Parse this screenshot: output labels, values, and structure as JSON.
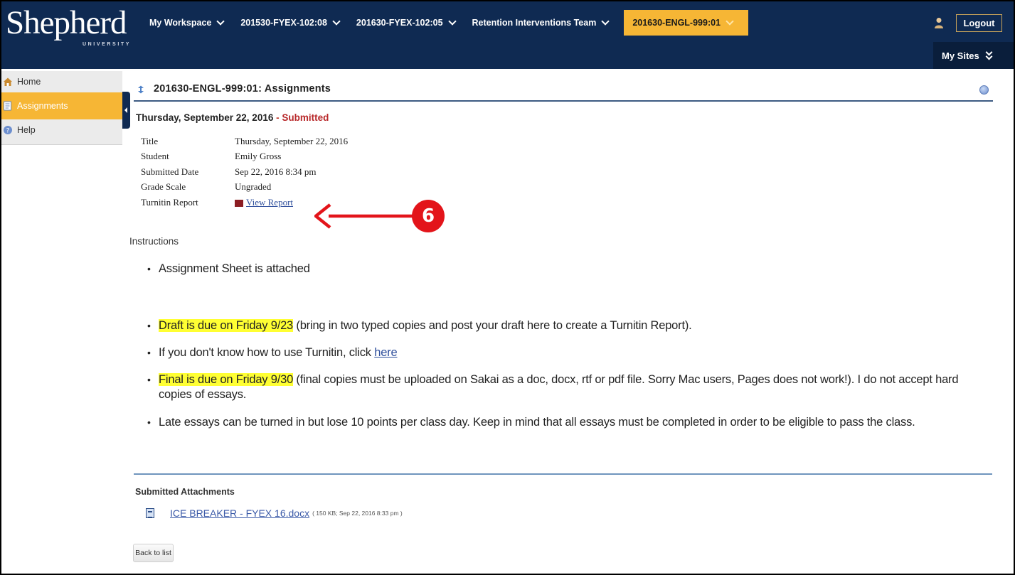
{
  "header": {
    "logo_text": "Shepherd",
    "logo_subtext": "UNIVERSITY",
    "nav_tabs": [
      {
        "label": "My Workspace"
      },
      {
        "label": "201530-FYEX-102:08"
      },
      {
        "label": "201630-FYEX-102:05"
      },
      {
        "label": "Retention Interventions Team"
      },
      {
        "label": "201630-ENGL-999:01",
        "active": true
      }
    ],
    "logout_label": "Logout",
    "my_sites_label": "My Sites"
  },
  "sidebar": {
    "items": [
      {
        "label": "Home",
        "icon": "home-icon"
      },
      {
        "label": "Assignments",
        "icon": "assignments-icon",
        "active": true
      },
      {
        "label": "Help",
        "icon": "help-icon"
      }
    ]
  },
  "main": {
    "page_title": "201630-ENGL-999:01: Assignments",
    "assignment_heading": "Thursday, September 22, 2016",
    "heading_separator": " - ",
    "status": "Submitted",
    "properties": [
      {
        "label": "Title",
        "value": "Thursday, September 22, 2016"
      },
      {
        "label": "Student",
        "value": "Emily Gross"
      },
      {
        "label": "Submitted Date",
        "value": "Sep 22, 2016 8:34 pm"
      },
      {
        "label": "Grade Scale",
        "value": "Ungraded"
      },
      {
        "label": "Turnitin Report",
        "value": "View Report"
      }
    ],
    "instructions_label": "Instructions",
    "instructions": {
      "item1": "Assignment Sheet is attached",
      "item2_highlight": "Draft is due on Friday 9/23",
      "item2_rest": " (bring in two typed copies and post your draft here to create a Turnitin Report).",
      "item3_text": "If you don't know how to use Turnitin, click ",
      "item3_link": "here",
      "item4_highlight": "Final is due on Friday 9/30",
      "item4_rest": " (final copies must be uploaded on Sakai as a doc, docx, rtf or pdf file. Sorry Mac users, Pages does not work!). I do not accept hard copies of essays.",
      "item5": "Late essays can be turned in but lose 10 points per class day. Keep in mind that all essays must be completed in order to be eligible to pass the class."
    },
    "attachments_heading": "Submitted Attachments",
    "attachment": {
      "name": "ICE BREAKER - FYEX 16.docx",
      "meta": "( 150 KB; Sep 22, 2016 8:33 pm )"
    },
    "back_button": "Back to list"
  },
  "annotation": {
    "step_number": "6",
    "color": "#e3141a"
  },
  "colors": {
    "header_bg": "#0f2a52",
    "accent": "#f6b635",
    "status_red": "#b8282a",
    "link_blue": "#2f4f9c",
    "highlight": "#ffff33"
  }
}
